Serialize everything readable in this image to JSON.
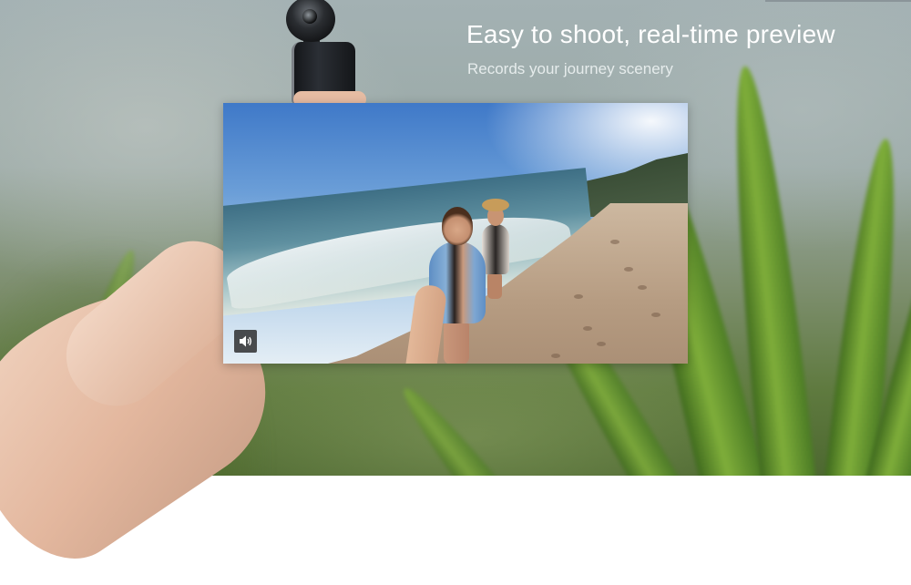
{
  "hero": {
    "title": "Easy to shoot, real-time preview",
    "subtitle": "Records your journey scenery"
  },
  "video": {
    "sound_icon": "speaker-volume-icon",
    "background_colors": {
      "sky": "#6c9fd8",
      "sand": "#b69c82",
      "sea": "#5f90a0"
    }
  },
  "background": {
    "camera_icon": "360-camera",
    "accent_grass": "#7fae3a"
  }
}
